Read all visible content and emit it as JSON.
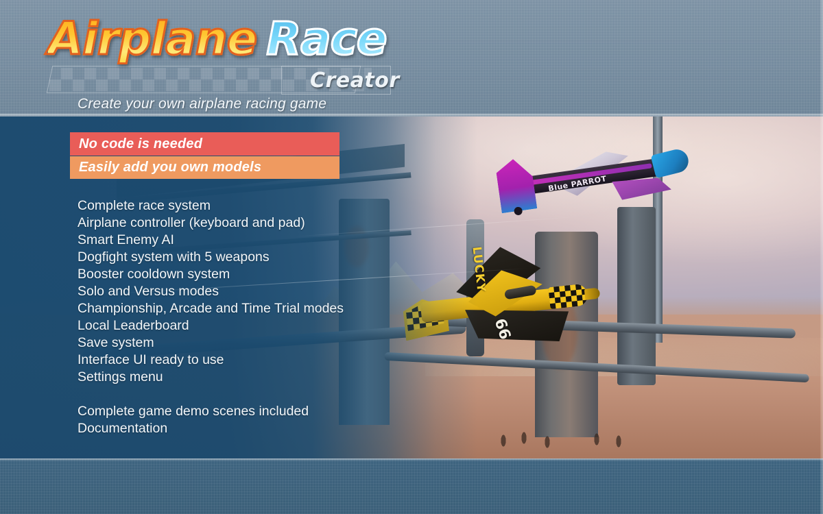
{
  "header": {
    "logo": {
      "word1": "Airplane",
      "word2": "Race",
      "word3": "Creator"
    },
    "subtitle": "Create your own airplane racing game"
  },
  "banners": [
    {
      "label": "No code is needed",
      "color": "#e95d58"
    },
    {
      "label": "Easily add you own models",
      "color": "#ef9a60"
    }
  ],
  "features": [
    "Complete race system",
    "Airplane controller (keyboard and pad)",
    "Smart Enemy AI",
    "Dogfight system with 5 weapons",
    "Booster cooldown system",
    "Solo and Versus modes",
    "Championship, Arcade and Time Trial modes",
    "Local Leaderboard",
    "Save system",
    "Interface UI ready to use",
    "Settings menu",
    "",
    "Complete game demo scenes included",
    "Documentation"
  ],
  "artwork": {
    "plane_purple": {
      "name": "Blue PARROT",
      "livery": "purple-blue"
    },
    "plane_yellow": {
      "name": "LUCKY",
      "number": "66",
      "livery": "yellow-black-checker"
    }
  }
}
